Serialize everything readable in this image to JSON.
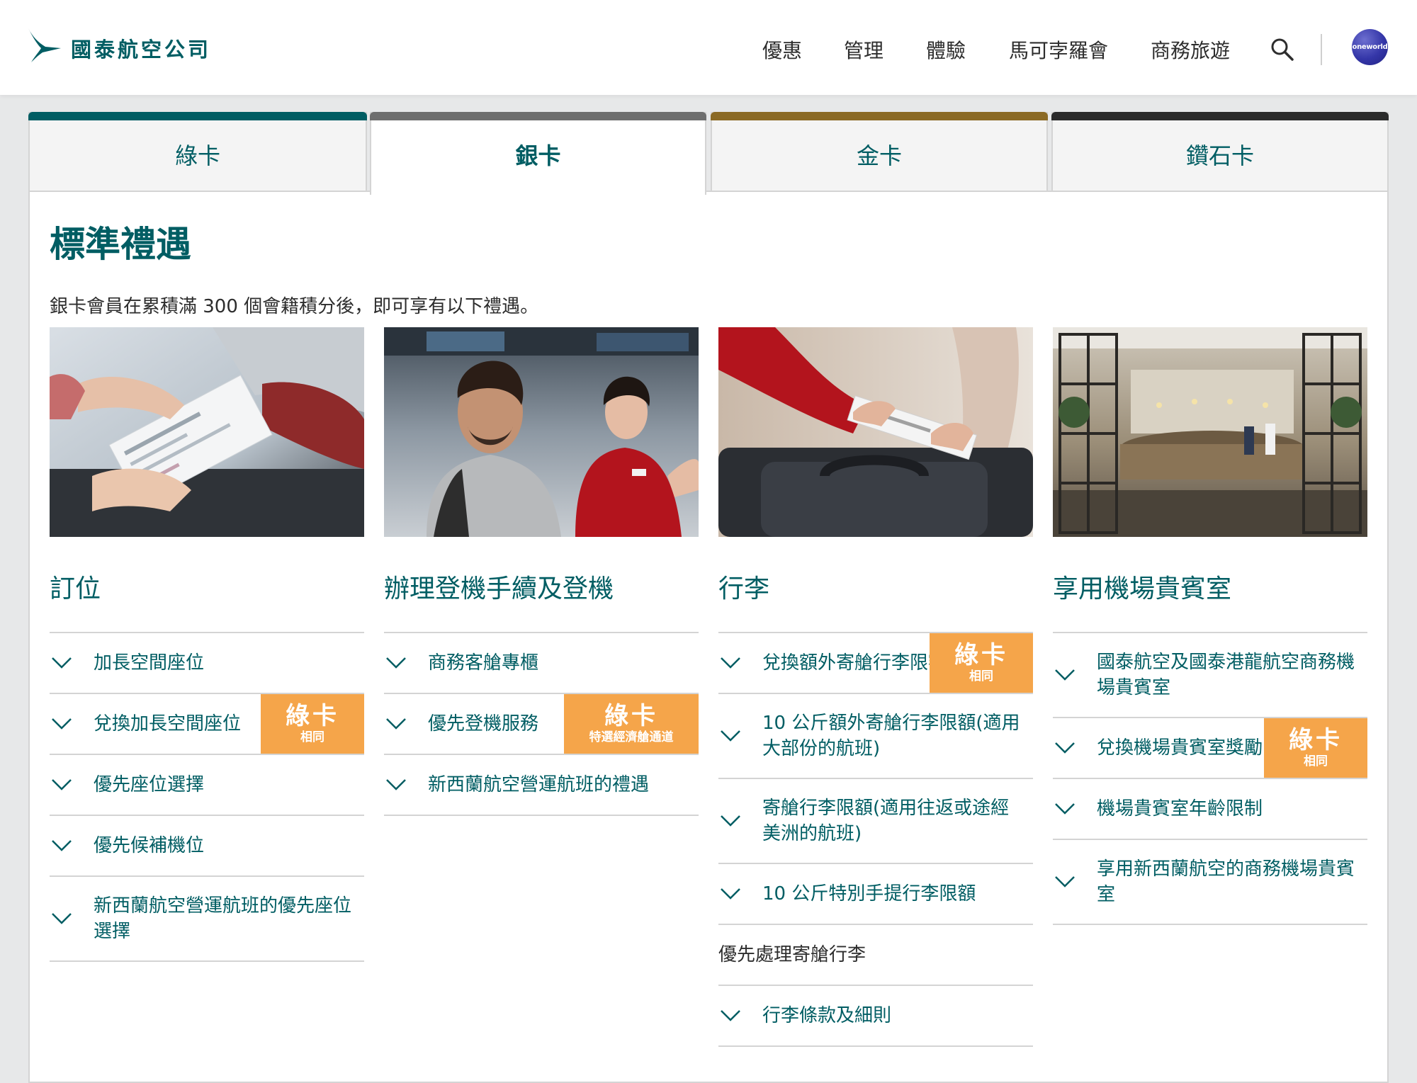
{
  "header": {
    "logo_text": "國泰航空公司",
    "nav": [
      "優惠",
      "管理",
      "體驗",
      "馬可孛羅會",
      "商務旅遊"
    ],
    "oneworld_label": "oneworld"
  },
  "tabs": [
    {
      "label": "綠卡",
      "color": "#005d63",
      "active": false
    },
    {
      "label": "銀卡",
      "color": "#6e6e6e",
      "active": true
    },
    {
      "label": "金卡",
      "color": "#8b6a25",
      "active": false
    },
    {
      "label": "鑽石卡",
      "color": "#2b2b2b",
      "active": false
    }
  ],
  "main": {
    "title": "標準禮遇",
    "intro": "銀卡會員在累積滿 300 個會籍積分後，即可享有以下禮遇。",
    "columns": [
      {
        "title": "訂位",
        "items": [
          {
            "label": "加長空間座位"
          },
          {
            "label": "兌換加長空間座位",
            "badge": {
              "main": "綠卡",
              "sub": "相同"
            }
          },
          {
            "label": "優先座位選擇"
          },
          {
            "label": "優先候補機位"
          },
          {
            "label": "新西蘭航空營運航班的優先座位選擇"
          }
        ]
      },
      {
        "title": "辦理登機手續及登機",
        "items": [
          {
            "label": "商務客艙專櫃"
          },
          {
            "label": "優先登機服務",
            "badge": {
              "main": "綠卡",
              "sub": "特選經濟艙通道"
            }
          },
          {
            "label": "新西蘭航空營運航班的禮遇"
          }
        ]
      },
      {
        "title": "行李",
        "items": [
          {
            "label": "兌換額外寄艙行李限額",
            "badge": {
              "main": "綠卡",
              "sub": "相同"
            }
          },
          {
            "label": "10 公斤額外寄艙行李限額(適用大部份的航班)"
          },
          {
            "label": "寄艙行李限額(適用往返或途經美洲的航班)"
          },
          {
            "label": "10 公斤特別手提行李限額"
          },
          {
            "label": "優先處理寄艙行李"
          },
          {
            "label": "行李條款及細則"
          }
        ]
      },
      {
        "title": "享用機場貴賓室",
        "items": [
          {
            "label": "國泰航空及國泰港龍航空商務機場貴賓室"
          },
          {
            "label": "兌換機場貴賓室獎勵",
            "badge": {
              "main": "綠卡",
              "sub": "相同"
            }
          },
          {
            "label": "機場貴賓室年齡限制"
          },
          {
            "label": "享用新西蘭航空的商務機場貴賓室"
          }
        ]
      }
    ]
  },
  "colors": {
    "brand": "#005d63",
    "badge": "#f5a54a"
  }
}
